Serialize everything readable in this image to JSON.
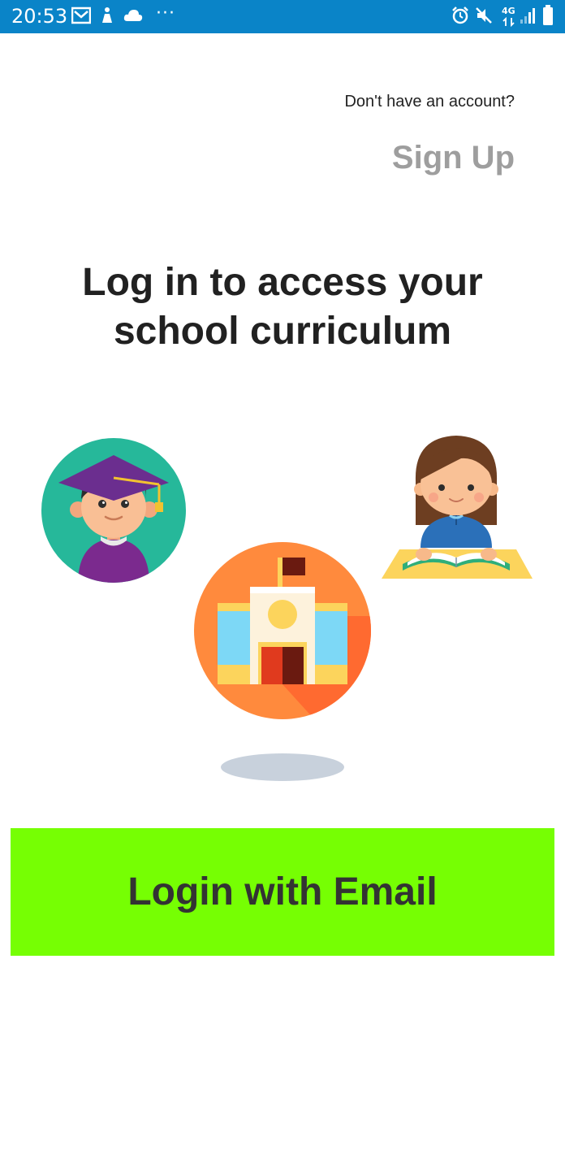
{
  "status_bar": {
    "time": "20:53",
    "more": "···",
    "network": "4G"
  },
  "header": {
    "no_account_text": "Don't have an account?",
    "signup_label": "Sign Up"
  },
  "main": {
    "headline_line1": "Log in to access your",
    "headline_line2": "school curriculum"
  },
  "illustration": {
    "student_icon": "graduate-boy-icon",
    "school_icon": "school-building-icon",
    "reader_icon": "girl-reading-icon"
  },
  "login": {
    "email_label": "Login with Email"
  },
  "colors": {
    "status_bar": "#0a84c8",
    "login_button": "#76ff03",
    "signup_text": "#9e9e9e",
    "headline_text": "#212121"
  }
}
